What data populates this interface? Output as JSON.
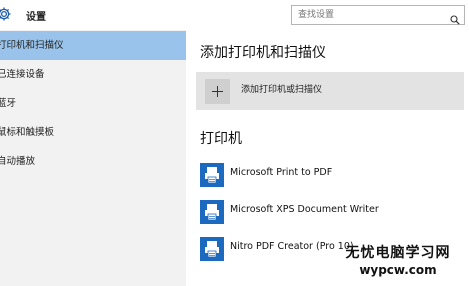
{
  "app": {
    "title": "设置",
    "icon": "gear-icon"
  },
  "search": {
    "placeholder": "查找设置",
    "icon": "search-icon"
  },
  "sidebar": {
    "items": [
      {
        "label": "打印机和扫描仪",
        "active": true
      },
      {
        "label": "已连接设备",
        "active": false
      },
      {
        "label": "蓝牙",
        "active": false
      },
      {
        "label": "鼠标和触摸板",
        "active": false
      },
      {
        "label": "自动播放",
        "active": false
      }
    ]
  },
  "main": {
    "add_section_title": "添加打印机和扫描仪",
    "add_button_label": "添加打印机或扫描仪",
    "printers_section_title": "打印机",
    "printers": [
      {
        "name": "Microsoft Print to PDF",
        "icon": "printer-icon"
      },
      {
        "name": "Microsoft XPS Document Writer",
        "icon": "printer-icon"
      },
      {
        "name": "Nitro PDF Creator (Pro 10)",
        "icon": "printer-icon"
      }
    ]
  },
  "watermark": {
    "line1": "无忧电脑学习网",
    "line2": "wypcw.com"
  },
  "colors": {
    "sidebar_bg": "#f2f2f2",
    "active_item_bg": "#99c3ea",
    "add_button_bg": "#e3e3e3",
    "printer_icon_blue": "#1b6ac0"
  }
}
